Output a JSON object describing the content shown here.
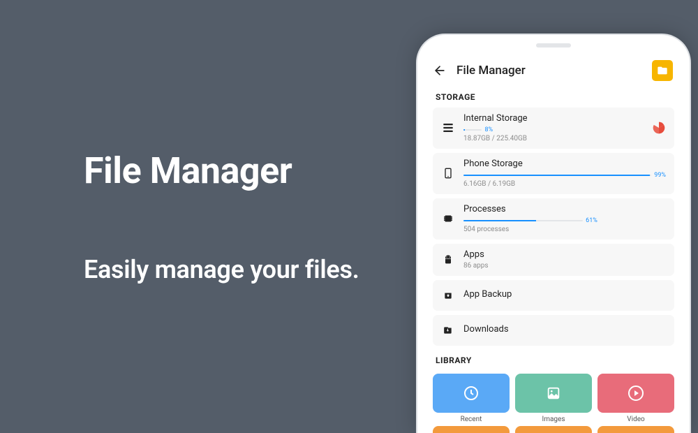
{
  "promo": {
    "title": "File Manager",
    "subtitle": "Easily manage your files."
  },
  "header": {
    "title": "File Manager"
  },
  "sections": {
    "storage_title": "STORAGE",
    "library_title": "LIBRARY"
  },
  "storage": {
    "internal": {
      "title": "Internal Storage",
      "percent_label": "8%",
      "percent": 8,
      "sub": "18.87GB / 225.40GB"
    },
    "phone": {
      "title": "Phone Storage",
      "percent_label": "99%",
      "percent": 99,
      "sub": "6.16GB / 6.19GB"
    },
    "processes": {
      "title": "Processes",
      "percent_label": "61%",
      "percent": 61,
      "sub": "504 processes"
    },
    "apps": {
      "title": "Apps",
      "sub": "86 apps"
    },
    "backup": {
      "title": "App Backup"
    },
    "downloads": {
      "title": "Downloads"
    }
  },
  "library": {
    "recent": "Recent",
    "images": "Images",
    "video": "Video"
  }
}
